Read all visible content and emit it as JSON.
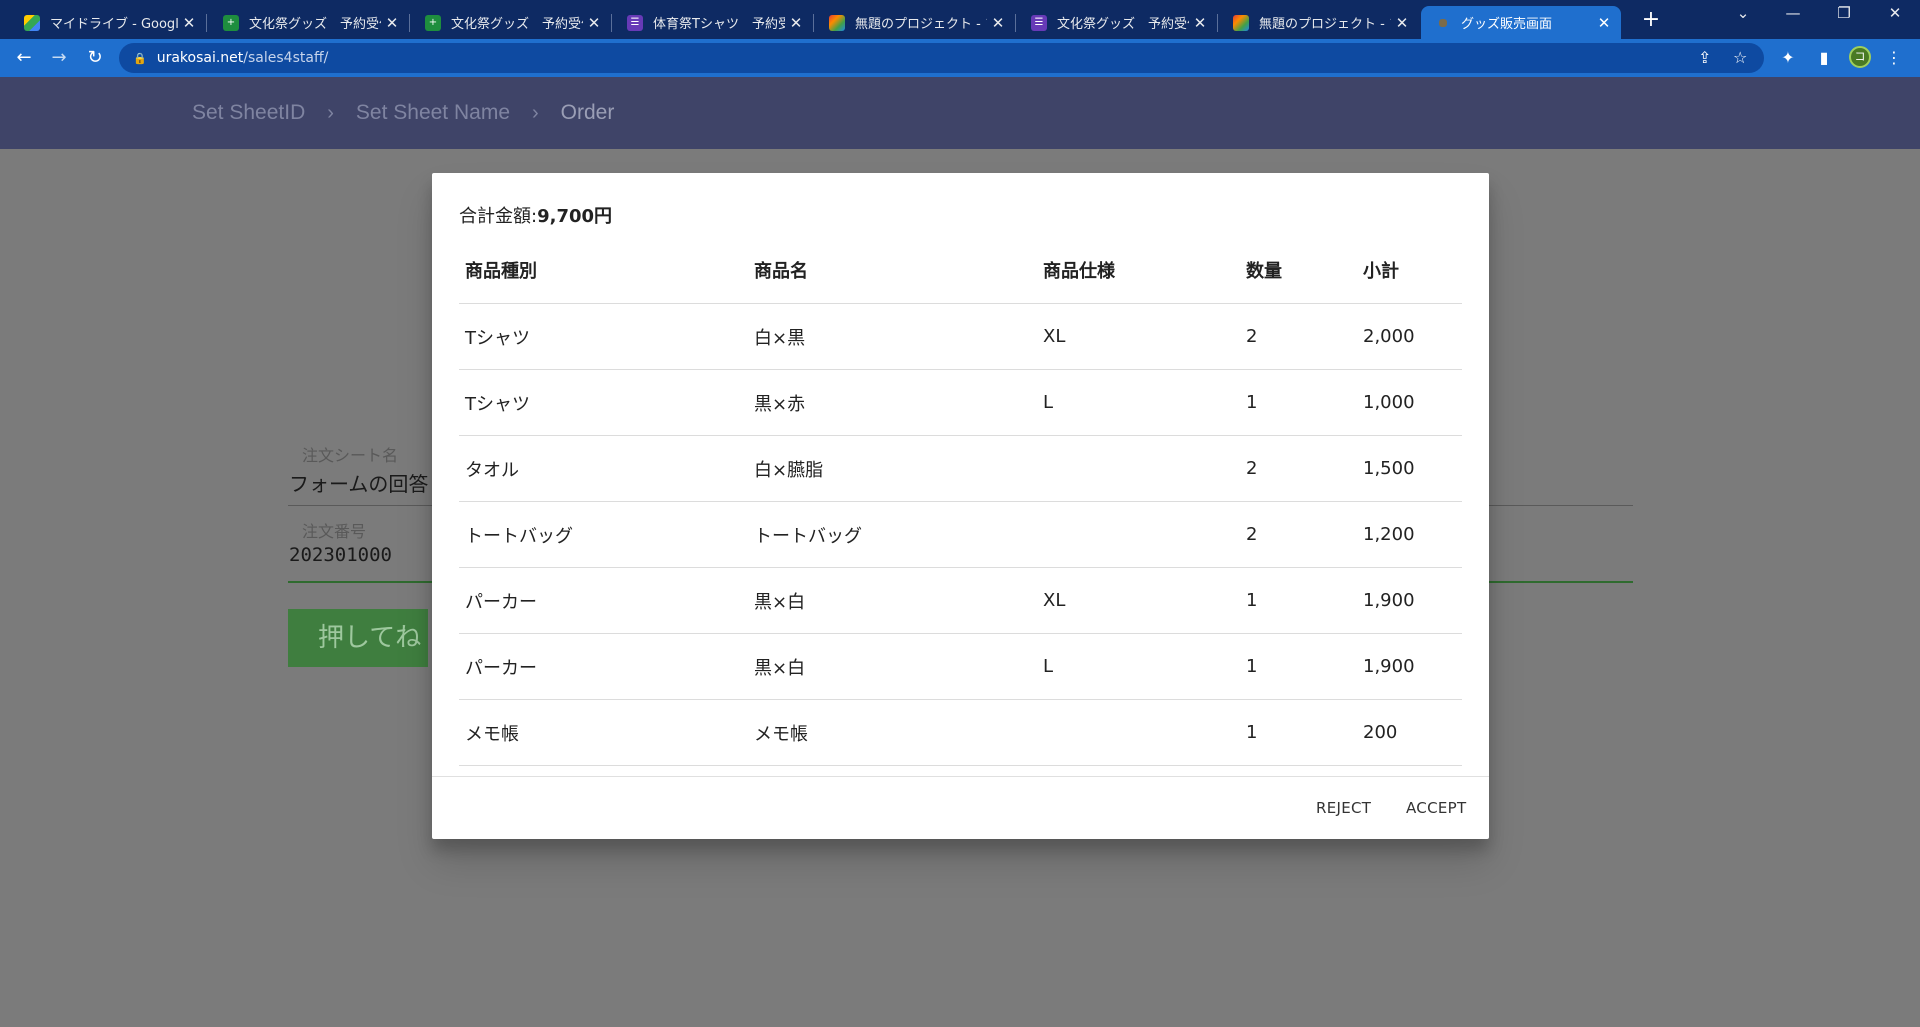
{
  "browser": {
    "tabs": [
      {
        "title": "マイドライブ - Google ド",
        "icon": "google-drive-icon"
      },
      {
        "title": "文化祭グッズ　予約受付",
        "icon": "google-sheets-icon"
      },
      {
        "title": "文化祭グッズ　予約受付",
        "icon": "google-sheets-icon"
      },
      {
        "title": "体育祭Tシャツ　予約受",
        "icon": "google-forms-icon"
      },
      {
        "title": "無題のプロジェクト - プロ",
        "icon": "apps-script-icon"
      },
      {
        "title": "文化祭グッズ　予約受付",
        "icon": "google-forms-icon"
      },
      {
        "title": "無題のプロジェクト - プロ",
        "icon": "apps-script-icon"
      },
      {
        "title": "グッズ販売画面",
        "icon": "site-icon"
      }
    ],
    "url_host": "urakosai.net",
    "url_path": "/sales4staff/",
    "profile_initial": "コ"
  },
  "breadcrumb": [
    "Set SheetID",
    "Set Sheet Name",
    "Order"
  ],
  "form": {
    "sheet_name_label": "注文シート名",
    "sheet_name_value": "フォームの回答",
    "order_no_label": "注文番号",
    "order_no_value": "202301000",
    "submit_label": "押してね"
  },
  "dialog": {
    "total_label": "合計金額:",
    "total_value": "9,700円",
    "columns": [
      "商品種別",
      "商品名",
      "商品仕様",
      "数量",
      "小計"
    ],
    "rows": [
      [
        "Tシャツ",
        "白×黒",
        "XL",
        "2",
        "2,000"
      ],
      [
        "Tシャツ",
        "黒×赤",
        "L",
        "1",
        "1,000"
      ],
      [
        "タオル",
        "白×臙脂",
        "",
        "2",
        "1,500"
      ],
      [
        "トートバッグ",
        "トートバッグ",
        "",
        "2",
        "1,200"
      ],
      [
        "パーカー",
        "黒×白",
        "XL",
        "1",
        "1,900"
      ],
      [
        "パーカー",
        "黒×白",
        "L",
        "1",
        "1,900"
      ],
      [
        "メモ帳",
        "メモ帳",
        "",
        "1",
        "200"
      ]
    ],
    "reject_label": "REJECT",
    "accept_label": "ACCEPT"
  }
}
